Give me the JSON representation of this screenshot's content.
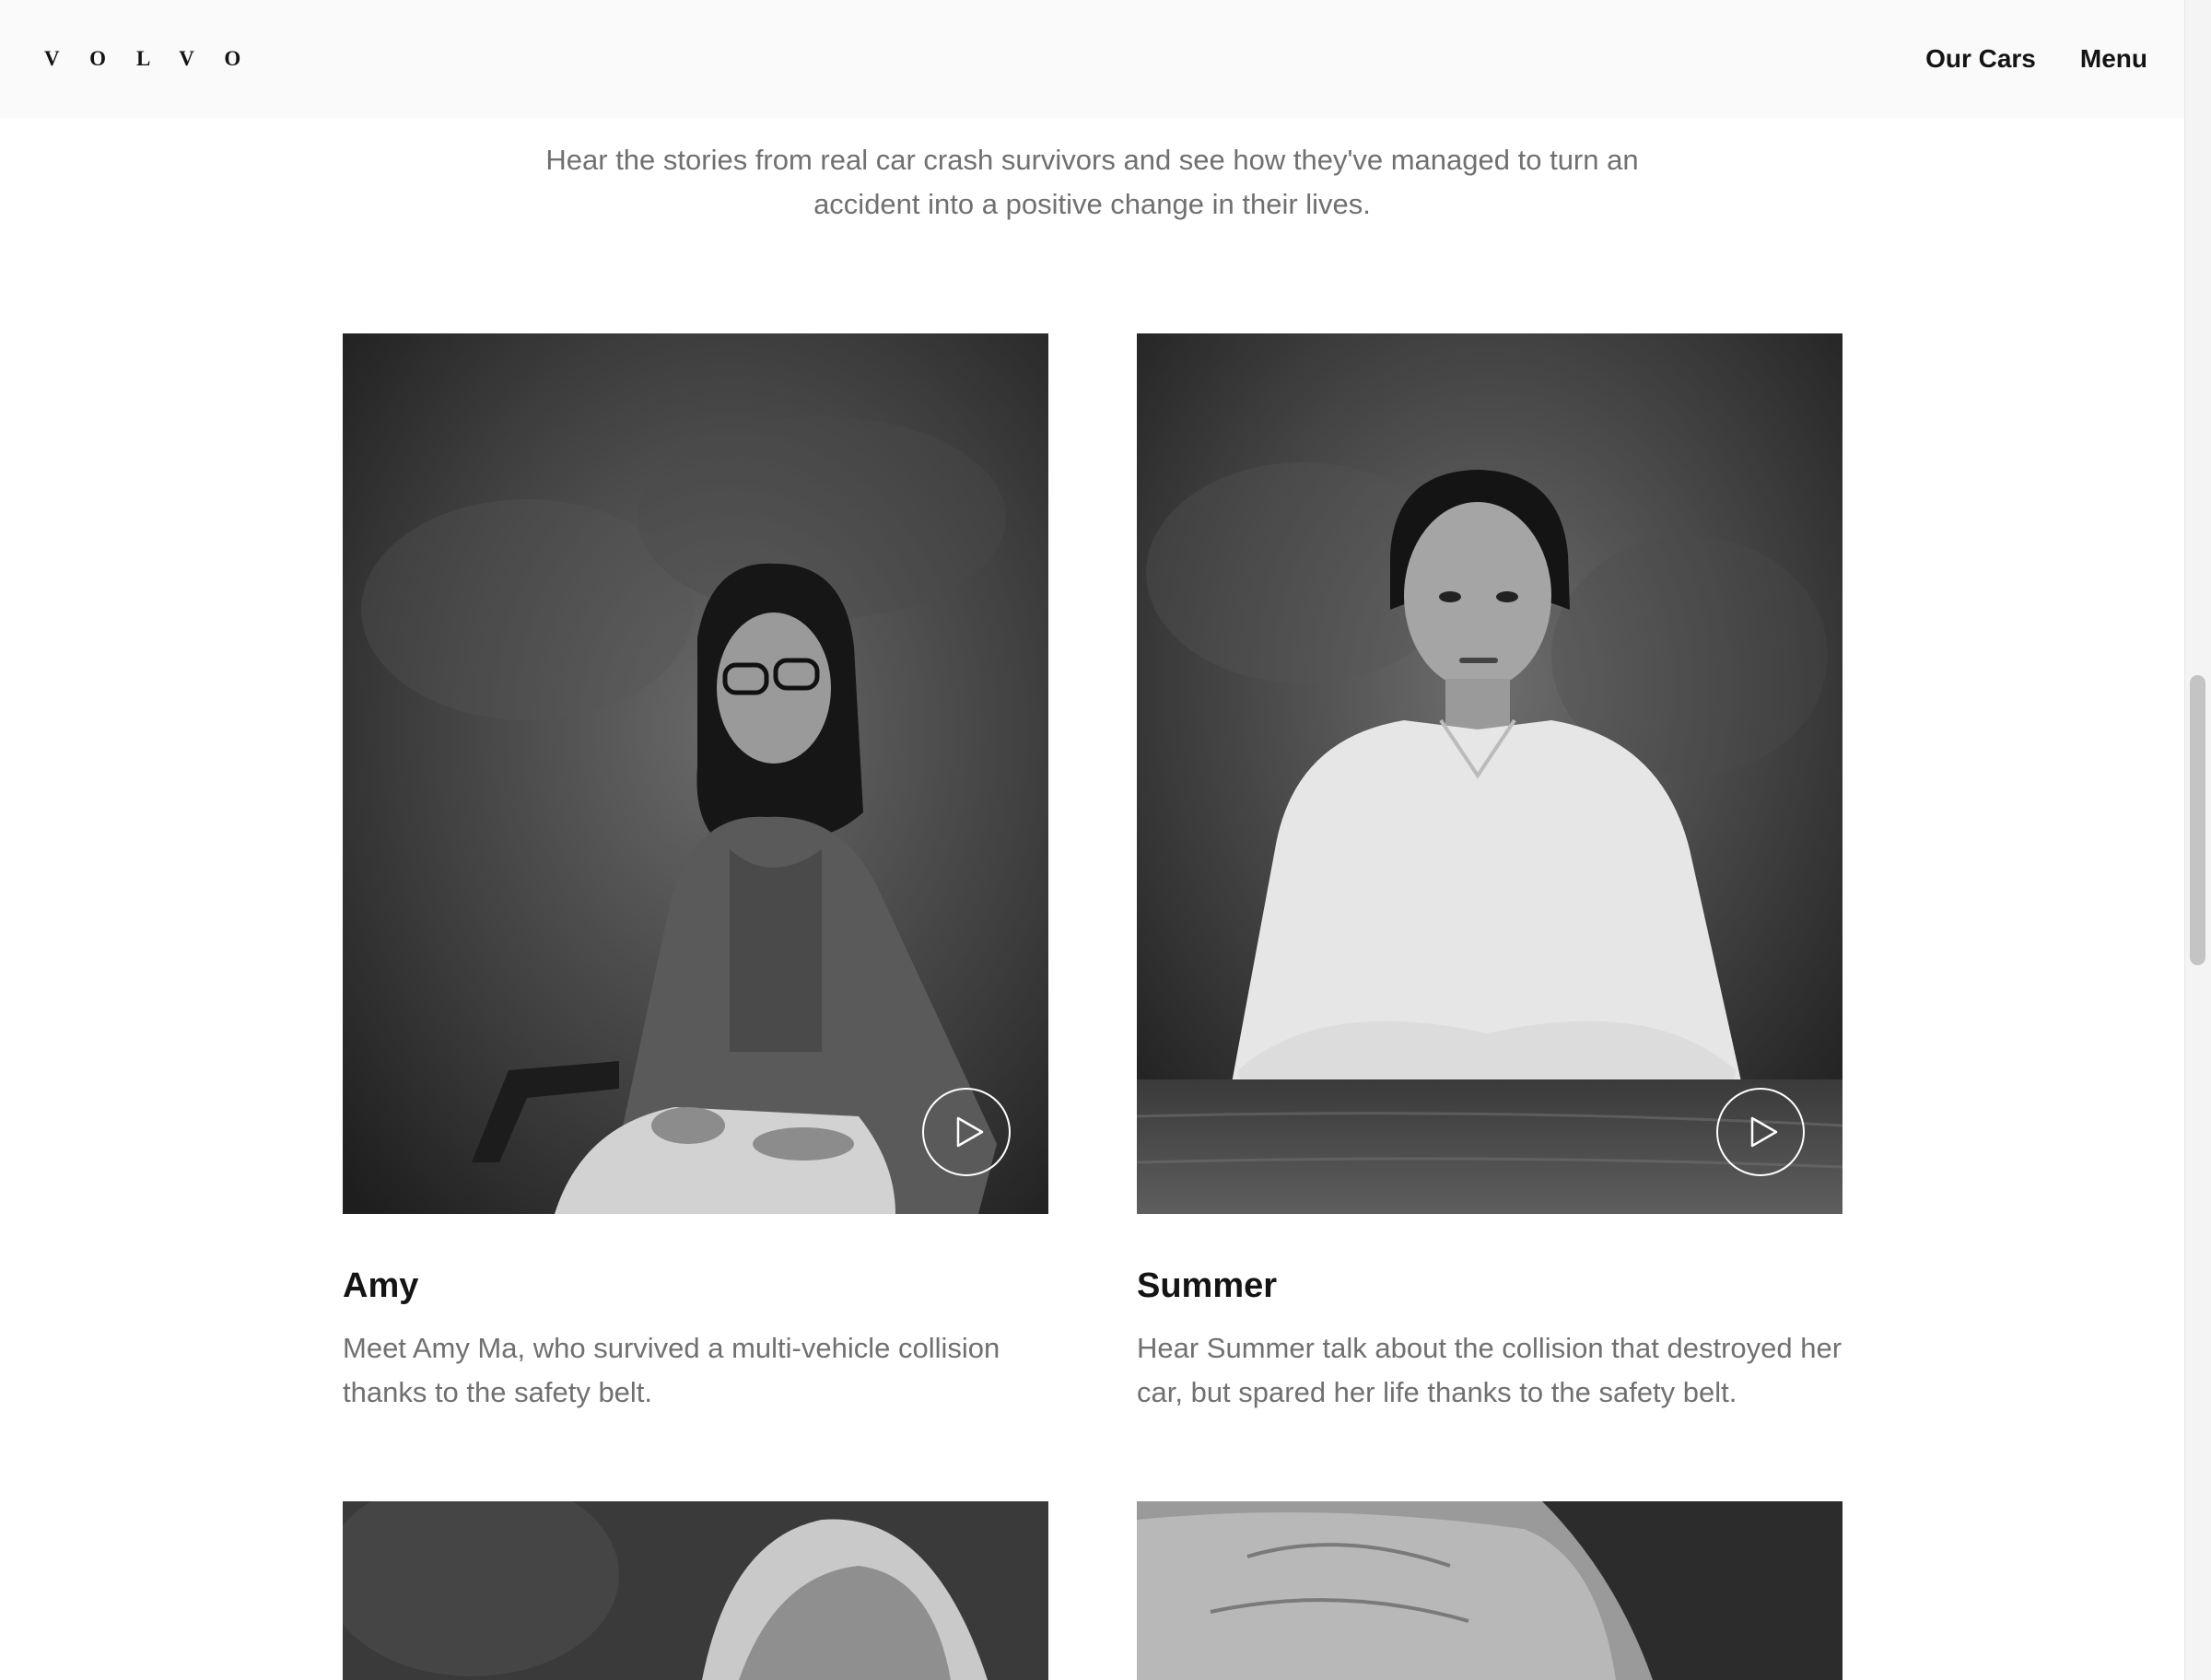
{
  "header": {
    "logo": "VOLVO",
    "nav": [
      {
        "label": "Our Cars"
      },
      {
        "label": "Menu"
      }
    ]
  },
  "intro": {
    "text": "Hear the stories from real car crash survivors and see how they've managed to turn an accident into a positive change in their lives."
  },
  "cards": [
    {
      "name": "Amy",
      "description": "Meet Amy Ma, who survived a multi-vehicle collision thanks to the safety belt.",
      "play_icon": "play-icon"
    },
    {
      "name": "Summer",
      "description": "Hear Summer talk about the collision that destroyed her car, but spared her life thanks to the safety belt.",
      "play_icon": "play-icon"
    }
  ],
  "colors": {
    "header_bg": "#fafafa",
    "text_primary": "#141414",
    "text_secondary": "#707070",
    "photo_bg": "#333333"
  }
}
